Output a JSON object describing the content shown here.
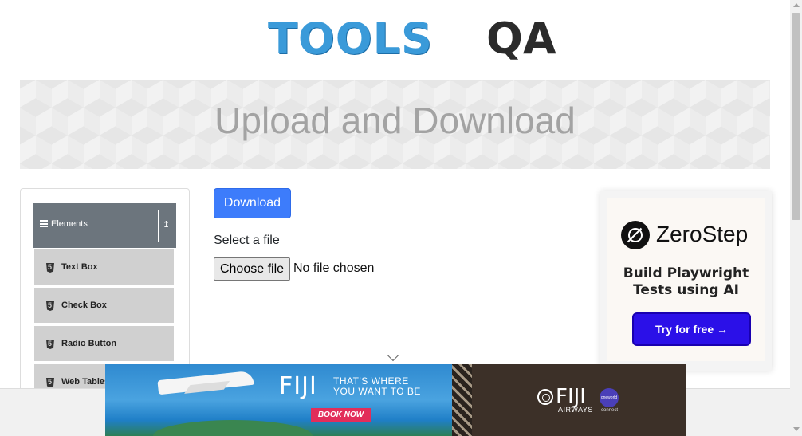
{
  "header": {
    "logo_primary": "TOOLS",
    "logo_secondary": "QA"
  },
  "banner": {
    "title": "Upload and Download"
  },
  "sidebar": {
    "group": {
      "label": "Elements",
      "icon": "menu-icon",
      "toggle_icon": "collapse-icon"
    },
    "items": [
      {
        "label": "Text Box",
        "icon": "html5-icon"
      },
      {
        "label": "Check Box",
        "icon": "html5-icon"
      },
      {
        "label": "Radio Button",
        "icon": "html5-icon"
      },
      {
        "label": "Web Tables",
        "icon": "html5-icon"
      }
    ]
  },
  "main": {
    "download_label": "Download",
    "select_label": "Select a file",
    "choose_label": "Choose file",
    "no_file_text": "No file chosen",
    "accent": "#3d7cfb"
  },
  "ad_zerostep": {
    "brand": "ZeroStep",
    "tagline": "Build Playwright Tests using AI",
    "cta": "Try for free →",
    "cta_color": "#2b10e8"
  },
  "ad_fiji": {
    "brand": "FIJI",
    "tagline_line1": "THAT'S WHERE",
    "tagline_line2": "YOU WANT TO BE",
    "book": "BOOK NOW",
    "airline": "FIJI",
    "airline_sub": "AIRWAYS",
    "partner": "oneworld",
    "partner_sub": "connect",
    "book_color": "#e22d5a"
  }
}
